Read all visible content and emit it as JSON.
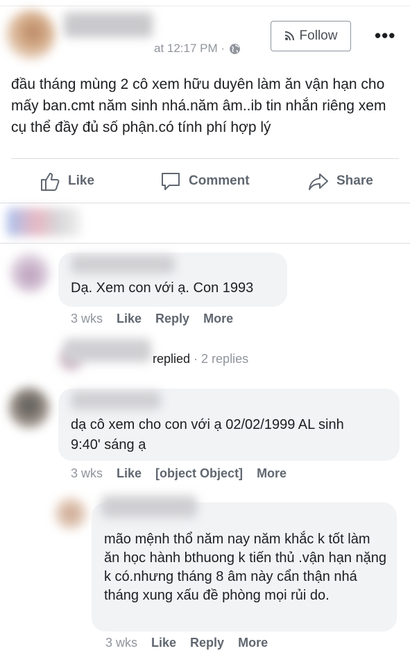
{
  "post": {
    "timestamp": "at 12:17 PM ·",
    "follow_label": "Follow",
    "more": "•••",
    "text": "đầu tháng mùng 2 cô xem hữu duyên làm ăn vận hạn cho mấy ban.cmt năm sinh nhá.năm âm..ib tin nhắn riêng xem cụ thể đầy đủ số phận.có tính phí hợp lý"
  },
  "actions": {
    "like": "Like",
    "comment": "Comment",
    "share": "Share"
  },
  "comments": [
    {
      "text": "Dạ. Xem con với ạ. Con 1993",
      "time": "3 wks",
      "like": "Like",
      "reply": "Reply",
      "more": "More",
      "replied_summary": {
        "verb": "replied",
        "count": " · 2 replies"
      }
    },
    {
      "text": "dạ cô xem cho con với ạ 02/02/1999 AL sinh 9:40' sáng ạ",
      "time": "3 wks",
      "like": "Like",
      "reply": {
        "text": "mão mệnh thổ năm nay năm khắc k tốt làm ăn học hành bthuong k tiến thủ .vận hạn nặng k có.nhưng tháng 8 âm này cẩn thận nhá tháng xung xấu đề phòng mọi rủi do.",
        "time": "3 wks",
        "like": "Like",
        "reply": "Reply",
        "more": "More"
      },
      "more": "More"
    }
  ],
  "colors": {
    "text": "#1c1e21",
    "muted": "#90949c",
    "action": "#606770",
    "bubble": "#f2f3f5"
  }
}
